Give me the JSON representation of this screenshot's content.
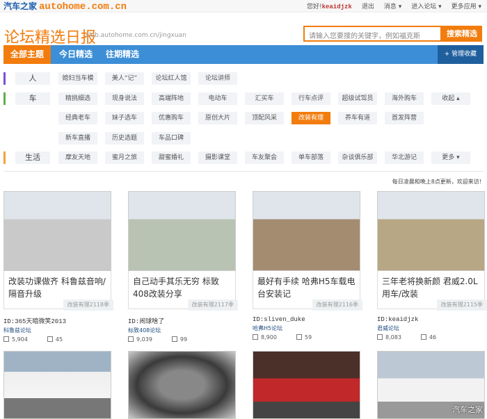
{
  "header": {
    "logo_cn": "汽车之家",
    "logo_en": "autohome.com.cn",
    "greeting": "您好!",
    "username": "keaidjzk",
    "logout": "退出",
    "messages": "消息 ▾",
    "forum": "进入论坛 ▾",
    "more_apps": "更多应用 ▾"
  },
  "site": {
    "title": "论坛精选日报",
    "url": "club.autohome.com.cn/jingxuan",
    "search_placeholder": "请输入您要搜的关键字，例如福克斯",
    "search_button": "搜索精选"
  },
  "nav": {
    "tabs": [
      "全部主题",
      "今日精选",
      "往期精选"
    ],
    "manage": "+ 管理收藏"
  },
  "filters": [
    {
      "label": "人",
      "color": "#7b4fd6",
      "rows": [
        [
          "媳妇当车模",
          "美人“记”",
          "论坛红人馆",
          "论坛讲师"
        ]
      ]
    },
    {
      "label": "车",
      "color": "#5fb04a",
      "rows": [
        [
          "精挑细选",
          "现身说法",
          "高端阵地",
          "电动车",
          "汇买车",
          "行车点评",
          "超级试驾员",
          "海外购车",
          "收起 ▴"
        ],
        [
          "经典老车",
          "妹子选车",
          "优惠购车",
          "原创大片",
          "顶配风采",
          "改装有理",
          "养车有道",
          "首发阵营"
        ],
        [
          "新车直播",
          "历史选题",
          "车品口碑"
        ]
      ]
    },
    {
      "label": "生活",
      "color": "#f2a23c",
      "rows": [
        [
          "摩友天地",
          "蜜月之旅",
          "甜蜜婚礼",
          "摄影课堂",
          "车友聚会",
          "单车部落",
          "杂谈俱乐部",
          "华北游记",
          "更多 ▾"
        ]
      ]
    }
  ],
  "active_filter": "改装有理",
  "notice": "每日凌晨和晚上8点更新，欢迎来访!",
  "cards": [
    {
      "title": "改装功课做齐 科鲁兹音响/隔音升级",
      "tag": "改装有理2118季",
      "id": "ID:365天暗微笑2013",
      "forum": "科鲁兹论坛",
      "views": "5,904",
      "replies": "45",
      "color": "#c9c9c9"
    },
    {
      "title": "自己动手其乐无穷 标致408改装分享",
      "tag": "改装有理2117季",
      "id": "ID:闹球啥了",
      "forum": "标致408论坛",
      "views": "9,039",
      "replies": "99",
      "color": "#b9c3b4"
    },
    {
      "title": "最好有手续 哈弗H5车载电台安装记",
      "tag": "改装有理2116季",
      "id": "ID:sliven_duke",
      "forum": "哈弗H5论坛",
      "views": "8,900",
      "replies": "59",
      "color": "#a38c70"
    },
    {
      "title": "三年老将换新颜 君威2.0L用车/改装",
      "tag": "改装有理2115季",
      "id": "ID:keaidjzk",
      "forum": "君威论坛",
      "views": "8,083",
      "replies": "46",
      "color": "#b8a784"
    }
  ],
  "watermark": "汽车之家"
}
